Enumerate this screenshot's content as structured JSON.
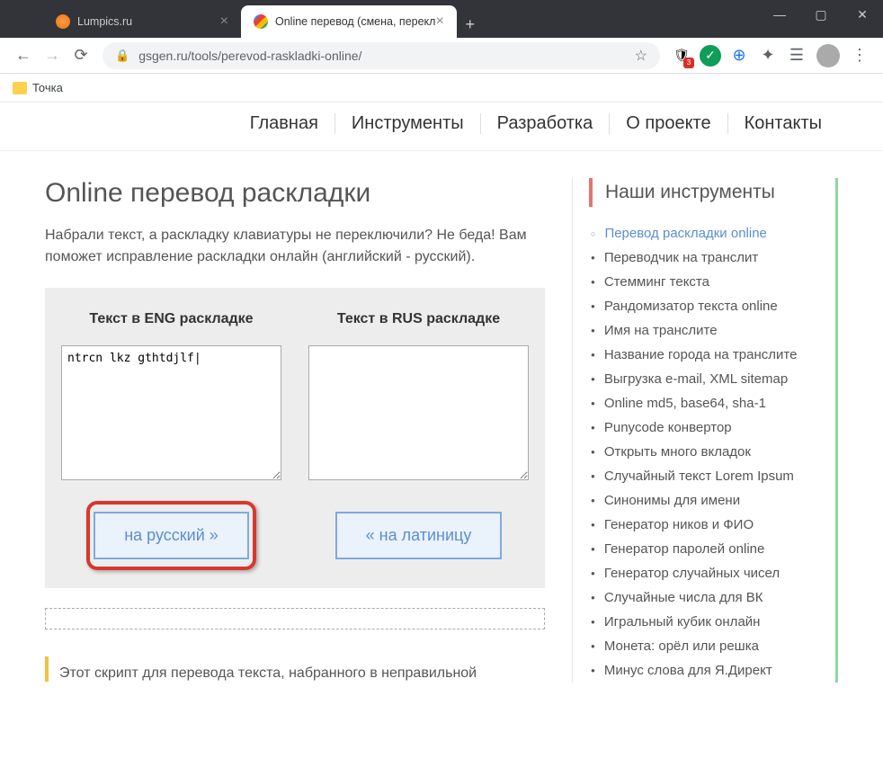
{
  "tabs": [
    {
      "title": "Lumpics.ru"
    },
    {
      "title": "Online перевод (смена, перекл"
    }
  ],
  "url": "gsgen.ru/tools/perevod-raskladki-online/",
  "bookmark": "Точка",
  "nav": [
    "Главная",
    "Инструменты",
    "Разработка",
    "О проекте",
    "Контакты"
  ],
  "page_title": "Online перевод раскладки",
  "intro": "Набрали текст, а раскладку клавиатуры не переключили? Не беда! Вам поможет исправление раскладки онлайн (английский - русский).",
  "eng_label": "Текст в ENG раскладке",
  "rus_label": "Текст в RUS раскладке",
  "eng_value": "ntrcn lkz gthtdjlf|",
  "rus_value": "",
  "btn_to_rus": "на русский »",
  "btn_to_lat": "« на латиницу",
  "footer_text": "Этот скрипт для перевода текста, набранного в неправильной",
  "sidebar_title": "Наши инструменты",
  "tools": [
    "Перевод раскладки online",
    "Переводчик на транслит",
    "Стемминг текста",
    "Рандомизатор текста online",
    "Имя на транслите",
    "Название города на транслите",
    "Выгрузка e-mail, XML sitemap",
    "Online md5, base64, sha-1",
    "Punycode конвертор",
    "Открыть много вкладок",
    "Случайный текст Lorem Ipsum",
    "Синонимы для имени",
    "Генератор ников и ФИО",
    "Генератор паролей online",
    "Генератор случайных чисел",
    "Случайные числа для ВК",
    "Игральный кубик онлайн",
    "Монета: орёл или решка",
    "Минус слова для Я.Директ"
  ]
}
